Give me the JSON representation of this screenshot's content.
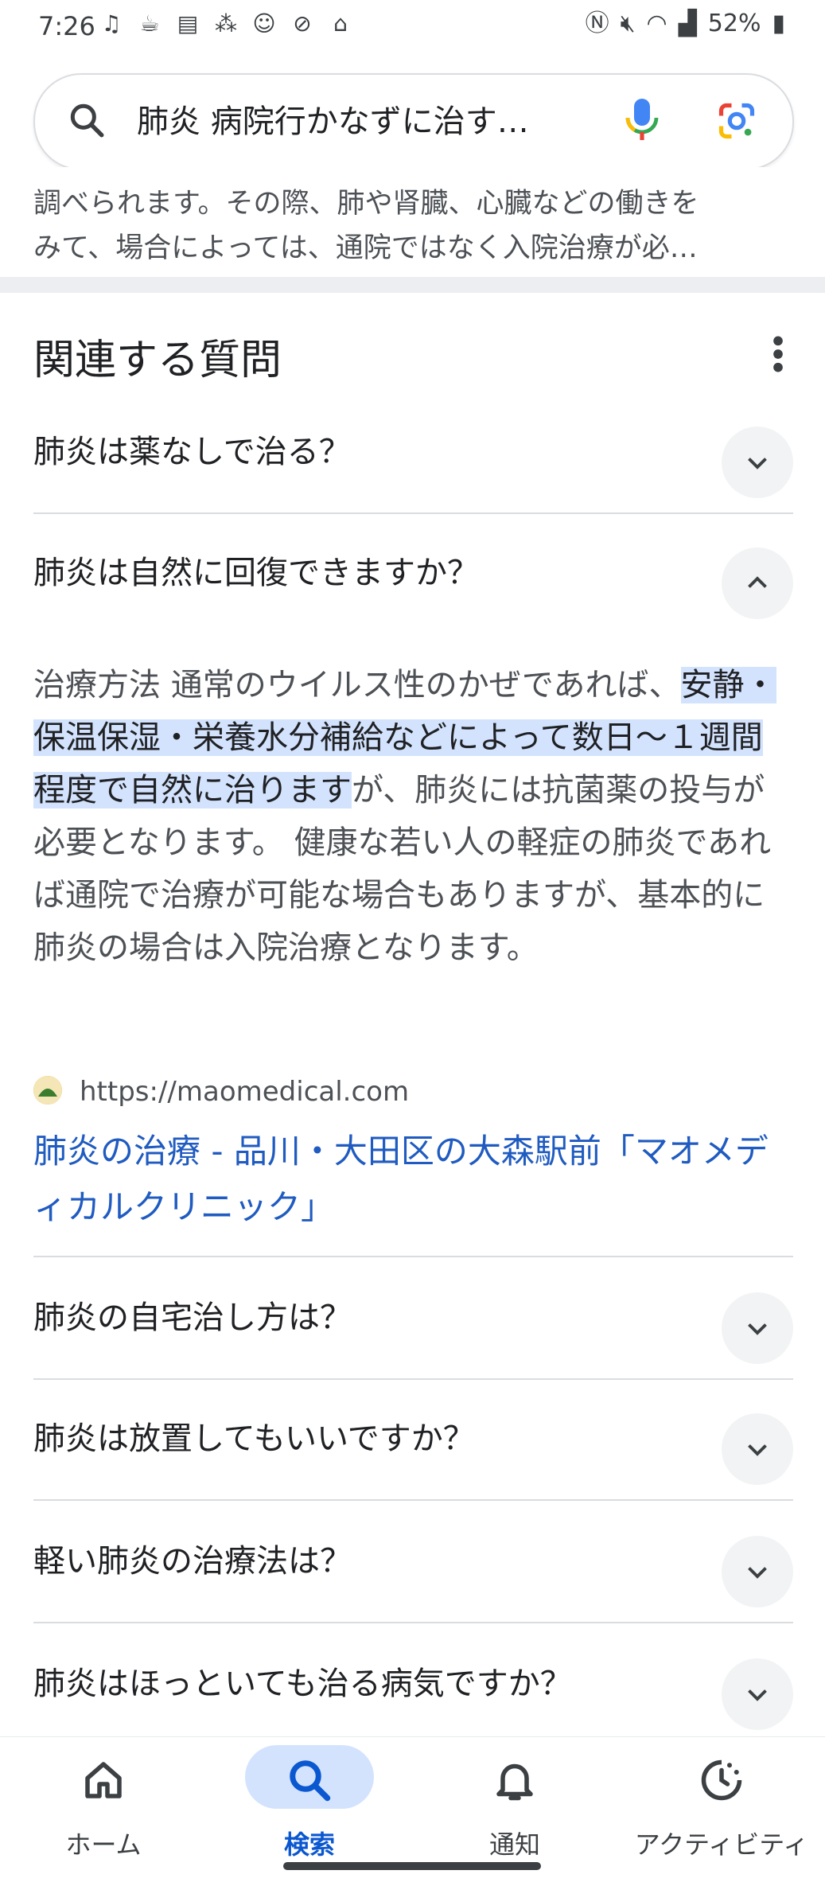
{
  "status_bar": {
    "time": "7:26",
    "battery": "52%"
  },
  "search": {
    "query": "肺炎 病院行かなずに治す…"
  },
  "top_fragment": {
    "line1": "調べられます。その際、肺や肾臓、心臓などの働きを",
    "line2": "みて、場合によっては、通院ではなく入院治療が必…"
  },
  "section": {
    "title": "関連する質問"
  },
  "questions": [
    {
      "text": "肺炎は薬なしで治る？",
      "expanded": false
    },
    {
      "text": "肺炎は自然に回復できますか？",
      "expanded": true
    },
    {
      "text": "肺炎の自宅治し方は？",
      "expanded": false
    },
    {
      "text": "肺炎は放置してもいいですか？",
      "expanded": false
    },
    {
      "text": "軽い肺炎の治療法は？",
      "expanded": false
    },
    {
      "text": "肺炎はほっといても治る病気ですか？",
      "expanded": false
    }
  ],
  "answer": {
    "before": "治療方法 通常のウイルス性のかぜであれば、",
    "highlight": "安静・保温保湿・栄養水分補給などによって数日～１週間程度で自然に治ります",
    "after": "が、肺炎には抗菌薬の投与が必要となります。 健康な若い人の軽症の肺炎であれば通院で治療が可能な場合もありますが、基本的に肺炎の場合は入院治療となります。"
  },
  "source": {
    "url": "https://maomedical.com",
    "title": "肺炎の治療 - 品川・大田区の大森駅前「マオメディカルクリニック」"
  },
  "bottom_nav": {
    "items": [
      {
        "label": "ホーム",
        "icon": "home-icon",
        "active": false
      },
      {
        "label": "検索",
        "icon": "search-icon",
        "active": true
      },
      {
        "label": "通知",
        "icon": "bell-icon",
        "active": false
      },
      {
        "label": "アクティビティ",
        "icon": "activity-icon",
        "active": false
      }
    ]
  },
  "colors": {
    "link": "#1f5bc0",
    "highlight": "#d3e3fd",
    "active_nav": "#0b57d0"
  }
}
